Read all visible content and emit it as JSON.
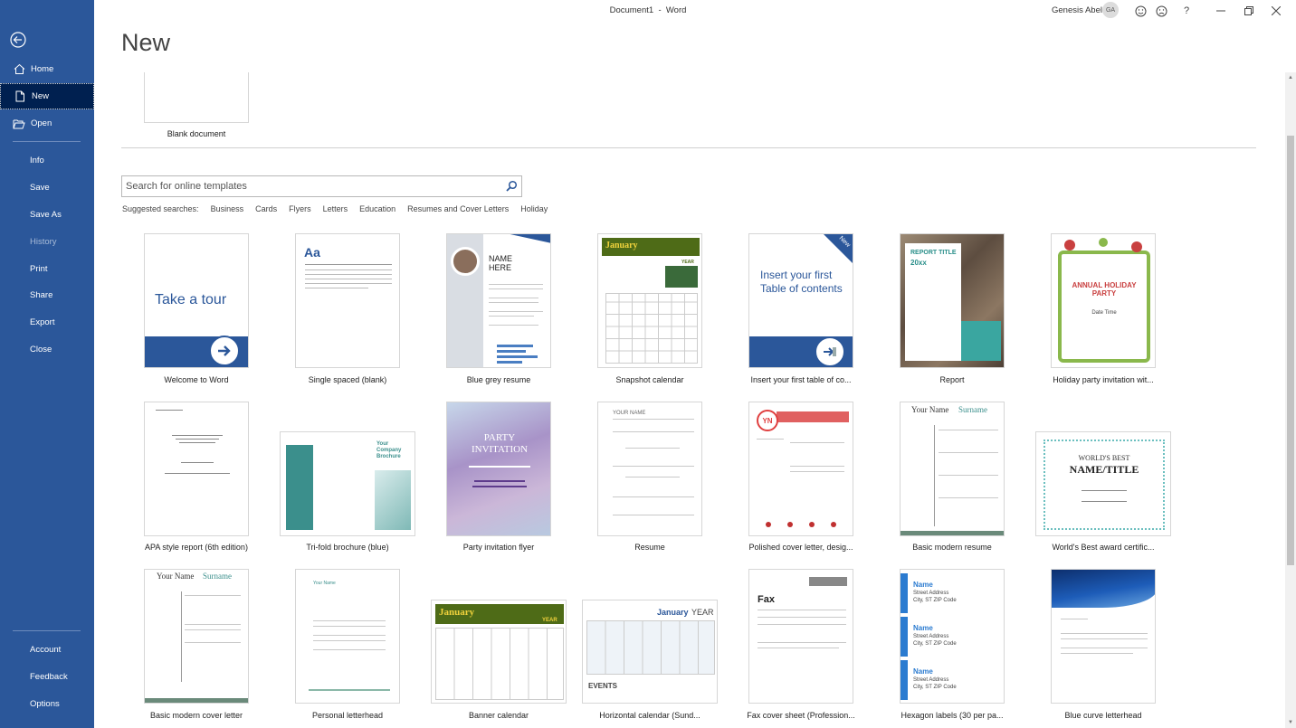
{
  "window": {
    "title": "Document1  -  Word",
    "user_name": "Genesis Abel",
    "user_initials": "GA",
    "help_label": "?"
  },
  "sidebar": {
    "items": [
      {
        "label": "Home"
      },
      {
        "label": "New"
      },
      {
        "label": "Open"
      },
      {
        "label": "Info"
      },
      {
        "label": "Save"
      },
      {
        "label": "Save As"
      },
      {
        "label": "History"
      },
      {
        "label": "Print"
      },
      {
        "label": "Share"
      },
      {
        "label": "Export"
      },
      {
        "label": "Close"
      },
      {
        "label": "Account"
      },
      {
        "label": "Feedback"
      },
      {
        "label": "Options"
      }
    ]
  },
  "main": {
    "page_title": "New",
    "blank_document_label": "Blank document",
    "search_placeholder": "Search for online templates",
    "suggested_label": "Suggested searches:",
    "suggested": [
      "Business",
      "Cards",
      "Flyers",
      "Letters",
      "Education",
      "Resumes and Cover Letters",
      "Holiday"
    ]
  },
  "templates": [
    {
      "label": "Welcome to Word",
      "thumb_text": "Take a tour"
    },
    {
      "label": "Single spaced (blank)",
      "thumb_text": "Aa"
    },
    {
      "label": "Blue grey resume",
      "thumb_text": "NAME HERE"
    },
    {
      "label": "Snapshot calendar",
      "thumb_text": "January",
      "thumb_text2": "YEAR"
    },
    {
      "label": "Insert your first table of co...",
      "thumb_text": "Insert your first Table of contents",
      "badge": "New"
    },
    {
      "label": "Report",
      "thumb_text": "REPORT TITLE",
      "thumb_text2": "20xx"
    },
    {
      "label": "Holiday party invitation wit...",
      "thumb_text": "ANNUAL HOLIDAY PARTY",
      "thumb_text2": "Date Time"
    },
    {
      "label": "APA style report (6th edition)"
    },
    {
      "label": "Tri-fold brochure (blue)",
      "thumb_text": "Your Company Brochure"
    },
    {
      "label": "Party invitation flyer",
      "thumb_text": "PARTY INVITATION"
    },
    {
      "label": "Resume",
      "thumb_text": "YOUR NAME"
    },
    {
      "label": "Polished cover letter, desig...",
      "thumb_text": "YN"
    },
    {
      "label": "Basic modern resume",
      "thumb_text": "Your Name",
      "thumb_text2": "Surname"
    },
    {
      "label": "World's Best award certific...",
      "thumb_text": "WORLD'S BEST",
      "thumb_text2": "NAME/TITLE"
    },
    {
      "label": "Basic modern cover letter",
      "thumb_text": "Your Name",
      "thumb_text2": "Surname"
    },
    {
      "label": "Personal letterhead",
      "thumb_text": "Your Name"
    },
    {
      "label": "Banner calendar",
      "thumb_text": "January",
      "thumb_text2": "YEAR"
    },
    {
      "label": "Horizontal calendar (Sund...",
      "thumb_text": "January",
      "thumb_text2": "YEAR",
      "thumb_text3": "EVENTS"
    },
    {
      "label": "Fax cover sheet (Profession...",
      "thumb_text": "Fax"
    },
    {
      "label": "Hexagon labels (30 per pa...",
      "thumb_text": "Name",
      "thumb_text2": "Street Address",
      "thumb_text3": "City, ST ZIP Code"
    },
    {
      "label": "Blue curve letterhead"
    }
  ],
  "colors": {
    "sidebar_bg": "#2b579a",
    "sidebar_active": "#002050",
    "accent_blue": "#2b579a",
    "calendar_green": "#4e6b17",
    "report_teal": "#3aa6a0"
  }
}
